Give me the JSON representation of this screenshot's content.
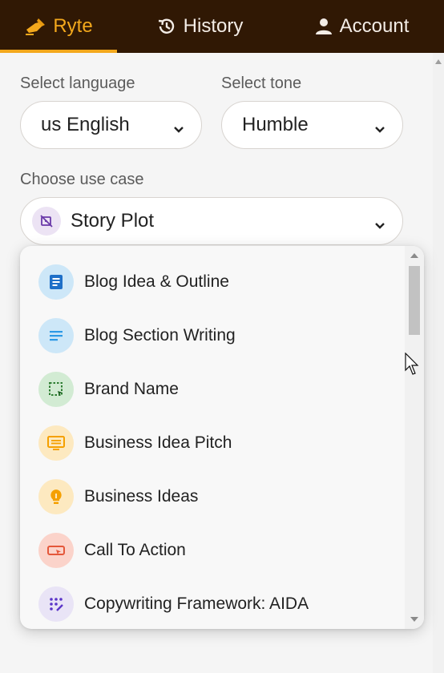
{
  "nav": {
    "tabs": [
      {
        "label": "Ryte",
        "icon": "hand-writing-icon",
        "active": true
      },
      {
        "label": "History",
        "icon": "history-icon",
        "active": false
      },
      {
        "label": "Account",
        "icon": "person-icon",
        "active": false
      }
    ],
    "accent": "#f3a81c",
    "background": "#301804"
  },
  "form": {
    "language_label": "Select language",
    "language_value": "us English",
    "tone_label": "Select tone",
    "tone_value": "Humble",
    "usecase_label": "Choose use case",
    "usecase_value": "Story Plot",
    "usecase_icon": "story-plot-icon"
  },
  "dropdown": {
    "items": [
      {
        "label": "Blog Idea & Outline",
        "icon": "blog-outline-icon",
        "color": "#1e7ad6",
        "bg": "#cde7f8"
      },
      {
        "label": "Blog Section Writing",
        "icon": "blog-section-icon",
        "color": "#2d9ae6",
        "bg": "#cde7f8"
      },
      {
        "label": "Brand Name",
        "icon": "brand-name-icon",
        "color": "#2e7d32",
        "bg": "#d2ebd3"
      },
      {
        "label": "Business Idea Pitch",
        "icon": "idea-pitch-icon",
        "color": "#f5a000",
        "bg": "#fde9c0"
      },
      {
        "label": "Business Ideas",
        "icon": "lightbulb-icon",
        "color": "#f5a000",
        "bg": "#fde9c0"
      },
      {
        "label": "Call To Action",
        "icon": "call-to-action-icon",
        "color": "#e4573a",
        "bg": "#fbd3ca"
      },
      {
        "label": "Copywriting Framework: AIDA",
        "icon": "framework-icon",
        "color": "#5b35c8",
        "bg": "#e9e4f6"
      }
    ]
  }
}
